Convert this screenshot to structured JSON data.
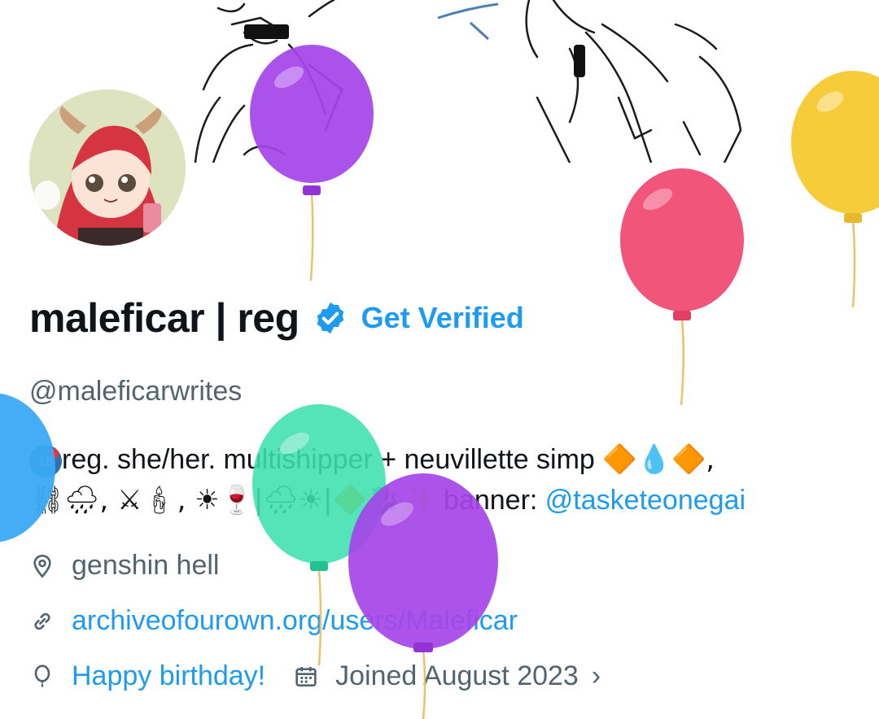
{
  "profile": {
    "display_name": "maleficar | reg",
    "get_verified_label": "Get Verified",
    "handle": "@maleficarwrites",
    "bio": {
      "line1_text": "reg. she/her. multishipper + neuvillette simp",
      "line1_age_badge": "18",
      "line1_emojis": "🔶💧🔶,",
      "line2_emojis": "⛓🌧, ⚔🕯, ☀🍷|🌧☀|🔶🐉✨",
      "line2_prefix": "banner: ",
      "line2_mention": "@tasketeonegai"
    },
    "location": "genshin hell",
    "website": "archiveofourown.org/users/Maleficar",
    "birthday_label": "Happy birthday!",
    "joined": "Joined August 2023"
  },
  "icons": {
    "verified": "verified-badge-icon",
    "location": "location-pin-icon",
    "link": "link-icon",
    "birthday": "balloon-icon",
    "calendar": "calendar-icon",
    "chevron": "chevron-right-icon"
  },
  "colors": {
    "accent": "#1d9bf0",
    "secondary_text": "#536471",
    "primary_text": "#0f1419",
    "balloon_purple": "#a545e8",
    "balloon_pink": "#f2557a",
    "balloon_yellow": "#f7cc3a",
    "balloon_teal": "#3ee0ad",
    "balloon_blue": "#3aa9f5"
  }
}
